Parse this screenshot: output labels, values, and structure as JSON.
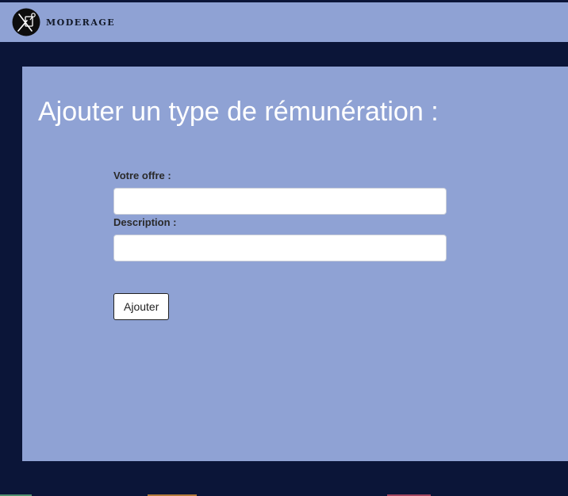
{
  "brand": {
    "name": "MODERAGE",
    "logo_icon": "tools-logo-icon"
  },
  "page": {
    "title": "Ajouter un type de rémunération :"
  },
  "form": {
    "offer_label": "Votre offre :",
    "offer_value": "",
    "description_label": "Description :",
    "description_value": "",
    "submit_label": "Ajouter"
  },
  "colors": {
    "page_background": "#0b1538",
    "panel_background": "#8fa2d4",
    "title_text": "#ffffff",
    "footer_strips": [
      "#4e8f6f",
      "#b27a3a",
      "#a2445d"
    ]
  }
}
